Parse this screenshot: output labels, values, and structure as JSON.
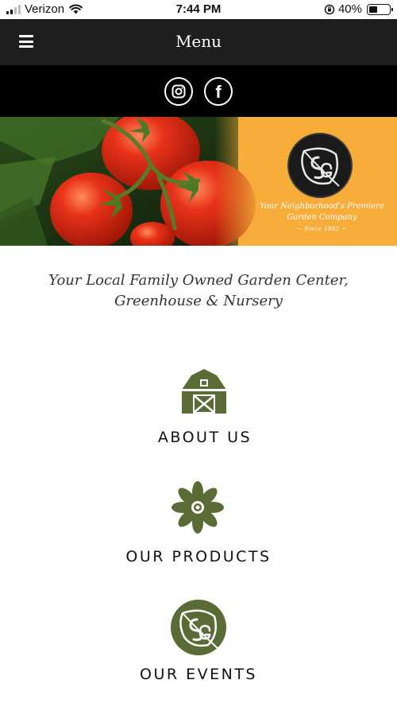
{
  "status_bar": {
    "carrier": "Verizon",
    "time": "7:44 PM",
    "battery": "40%",
    "battery_level": 0.4
  },
  "nav": {
    "title": "Menu",
    "menu_icon": "hamburger-icon"
  },
  "social": [
    {
      "name": "instagram",
      "icon": "instagram-icon"
    },
    {
      "name": "facebook",
      "icon": "facebook-icon",
      "glyph": "f"
    }
  ],
  "banner": {
    "tagline_line1": "Your Neighborhood's Premiere",
    "tagline_line2": "Garden Company",
    "since": "~ Since 1982 ~",
    "background_color": "#f8ad3a"
  },
  "headline": {
    "line1": "Your Local Family Owned Garden Center,",
    "line2": "Greenhouse & Nursery"
  },
  "sections": [
    {
      "label": "ABOUT US",
      "icon": "barn-icon"
    },
    {
      "label": "OUR PRODUCTS",
      "icon": "flower-icon"
    },
    {
      "label": "OUR EVENTS",
      "icon": "leaf-logo-icon"
    }
  ],
  "colors": {
    "accent_green": "#5b6b35",
    "nav_bg": "#1e1e1e",
    "social_bg": "#000000"
  }
}
